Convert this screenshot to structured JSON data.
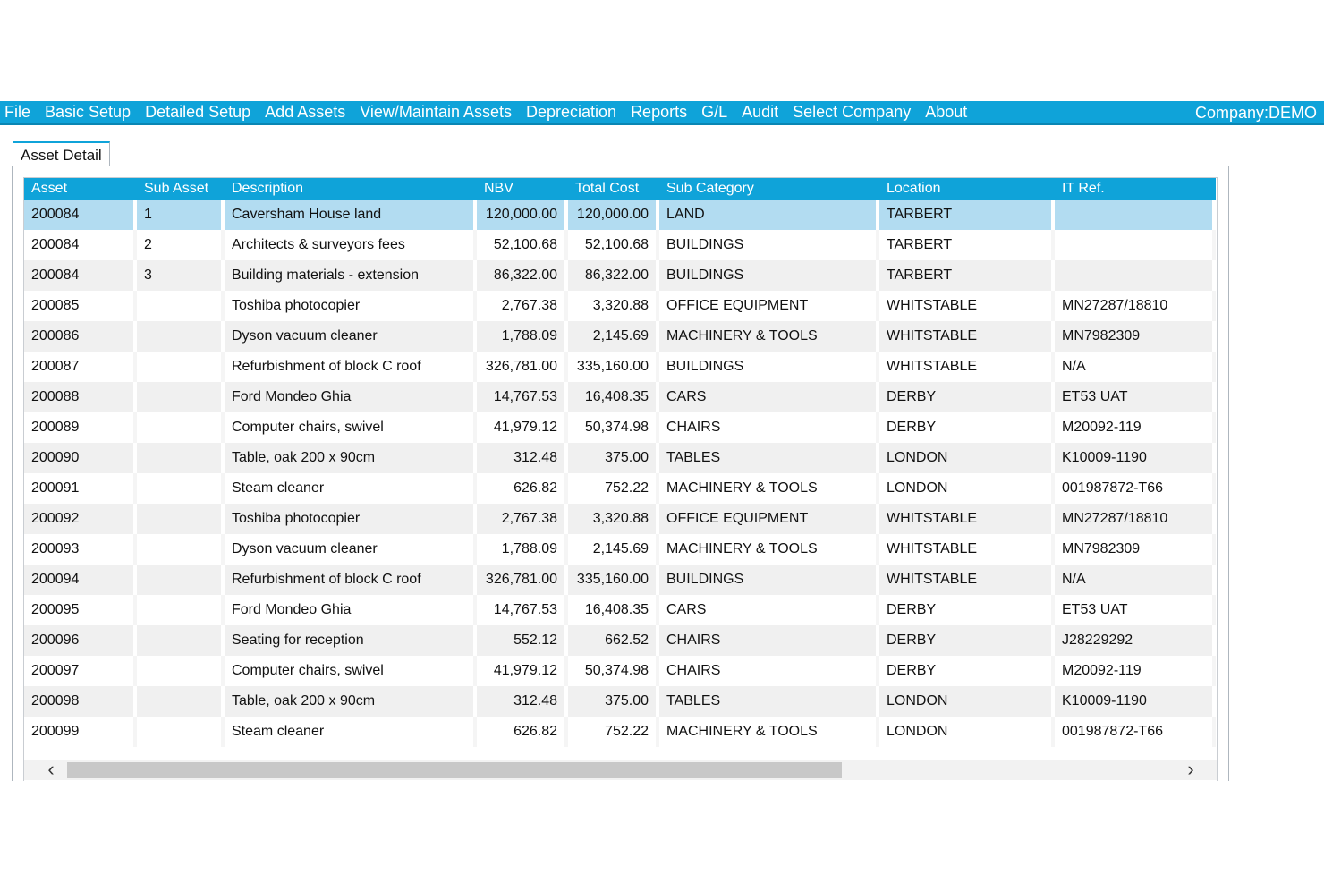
{
  "menu": {
    "items": [
      "File",
      "Basic Setup",
      "Detailed Setup",
      "Add Assets",
      "View/Maintain Assets",
      "Depreciation",
      "Reports",
      "G/L",
      "Audit",
      "Select Company",
      "About"
    ],
    "company": "Company:DEMO"
  },
  "tab": {
    "label": "Asset Detail"
  },
  "table": {
    "columns": [
      "Asset",
      "Sub Asset",
      "Description",
      "NBV",
      "Total Cost",
      "Sub Category",
      "Location",
      "IT Ref."
    ],
    "selected_row": 0,
    "rows": [
      [
        "200084",
        "1",
        "Caversham House land",
        "120,000.00",
        "120,000.00",
        "LAND",
        "TARBERT",
        ""
      ],
      [
        "200084",
        "2",
        "Architects & surveyors fees",
        "52,100.68",
        "52,100.68",
        "BUILDINGS",
        "TARBERT",
        ""
      ],
      [
        "200084",
        "3",
        "Building materials - extension",
        "86,322.00",
        "86,322.00",
        "BUILDINGS",
        "TARBERT",
        ""
      ],
      [
        "200085",
        "",
        "Toshiba photocopier",
        "2,767.38",
        "3,320.88",
        "OFFICE EQUIPMENT",
        "WHITSTABLE",
        "MN27287/18810"
      ],
      [
        "200086",
        "",
        "Dyson vacuum cleaner",
        "1,788.09",
        "2,145.69",
        "MACHINERY & TOOLS",
        "WHITSTABLE",
        "MN7982309"
      ],
      [
        "200087",
        "",
        "Refurbishment of block C roof",
        "326,781.00",
        "335,160.00",
        "BUILDINGS",
        "WHITSTABLE",
        "N/A"
      ],
      [
        "200088",
        "",
        "Ford Mondeo Ghia",
        "14,767.53",
        "16,408.35",
        "CARS",
        "DERBY",
        "ET53 UAT"
      ],
      [
        "200089",
        "",
        "Computer chairs, swivel",
        "41,979.12",
        "50,374.98",
        "CHAIRS",
        "DERBY",
        "M20092-119"
      ],
      [
        "200090",
        "",
        "Table, oak 200 x 90cm",
        "312.48",
        "375.00",
        "TABLES",
        "LONDON",
        "K10009-1190"
      ],
      [
        "200091",
        "",
        "Steam cleaner",
        "626.82",
        "752.22",
        "MACHINERY & TOOLS",
        "LONDON",
        "001987872-T66"
      ],
      [
        "200092",
        "",
        "Toshiba photocopier",
        "2,767.38",
        "3,320.88",
        "OFFICE EQUIPMENT",
        "WHITSTABLE",
        "MN27287/18810"
      ],
      [
        "200093",
        "",
        "Dyson vacuum cleaner",
        "1,788.09",
        "2,145.69",
        "MACHINERY & TOOLS",
        "WHITSTABLE",
        "MN7982309"
      ],
      [
        "200094",
        "",
        "Refurbishment of block C roof",
        "326,781.00",
        "335,160.00",
        "BUILDINGS",
        "WHITSTABLE",
        "N/A"
      ],
      [
        "200095",
        "",
        "Ford Mondeo Ghia",
        "14,767.53",
        "16,408.35",
        "CARS",
        "DERBY",
        "ET53 UAT"
      ],
      [
        "200096",
        "",
        "Seating for reception",
        "552.12",
        "662.52",
        "CHAIRS",
        "DERBY",
        "J28229292"
      ],
      [
        "200097",
        "",
        "Computer chairs, swivel",
        "41,979.12",
        "50,374.98",
        "CHAIRS",
        "DERBY",
        "M20092-119"
      ],
      [
        "200098",
        "",
        "Table, oak 200 x 90cm",
        "312.48",
        "375.00",
        "TABLES",
        "LONDON",
        "K10009-1190"
      ],
      [
        "200099",
        "",
        "Steam cleaner",
        "626.82",
        "752.22",
        "MACHINERY & TOOLS",
        "LONDON",
        "001987872-T66"
      ]
    ]
  },
  "scrollbar": {
    "position": 0.0,
    "visible_fraction": 0.7
  },
  "icons": {
    "scroll_left": "chevron-left-icon",
    "scroll_right": "chevron-right-icon"
  },
  "colors": {
    "accent": "#0fa3d9",
    "selected_row": "#b2dcf1"
  }
}
